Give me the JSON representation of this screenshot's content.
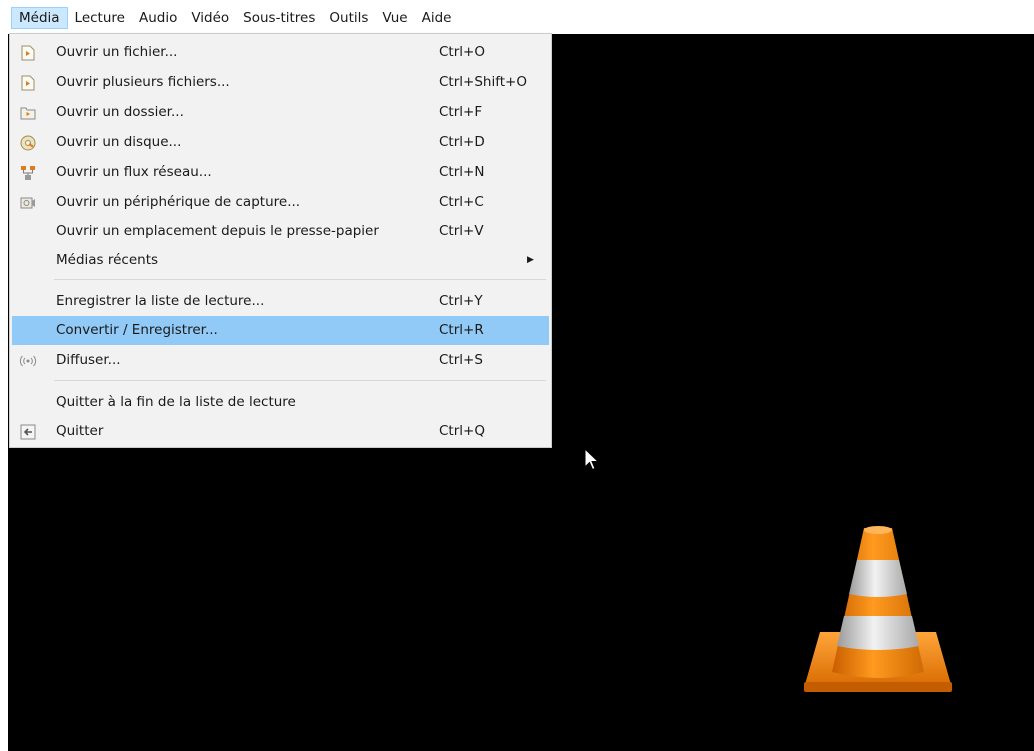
{
  "menubar": {
    "items": [
      {
        "label": "Média",
        "active": true
      },
      {
        "label": "Lecture"
      },
      {
        "label": "Audio"
      },
      {
        "label": "Vidéo"
      },
      {
        "label": "Sous-titres"
      },
      {
        "label": "Outils"
      },
      {
        "label": "Vue"
      },
      {
        "label": "Aide"
      }
    ]
  },
  "media_menu": {
    "open_file": {
      "label": "Ouvrir un fichier...",
      "shortcut": "Ctrl+O"
    },
    "open_files": {
      "label": "Ouvrir plusieurs fichiers...",
      "shortcut": "Ctrl+Shift+O"
    },
    "open_folder": {
      "label": "Ouvrir un dossier...",
      "shortcut": "Ctrl+F"
    },
    "open_disc": {
      "label": "Ouvrir un disque...",
      "shortcut": "Ctrl+D"
    },
    "open_network": {
      "label": "Ouvrir un flux réseau...",
      "shortcut": "Ctrl+N"
    },
    "open_capture": {
      "label": "Ouvrir un périphérique de capture...",
      "shortcut": "Ctrl+C"
    },
    "open_clipboard": {
      "label": "Ouvrir un emplacement depuis le presse-papier",
      "shortcut": "Ctrl+V"
    },
    "recent_media": {
      "label": "Médias récents"
    },
    "save_playlist": {
      "label": "Enregistrer la liste de lecture...",
      "shortcut": "Ctrl+Y"
    },
    "convert_save": {
      "label": "Convertir / Enregistrer...",
      "shortcut": "Ctrl+R",
      "highlighted": true
    },
    "stream": {
      "label": "Diffuser...",
      "shortcut": "Ctrl+S"
    },
    "quit_end_playlist": {
      "label": "Quitter à la fin de la liste de lecture"
    },
    "quit": {
      "label": "Quitter",
      "shortcut": "Ctrl+Q"
    }
  },
  "colors": {
    "highlight": "#91c9f7",
    "menu_bg": "#f2f2f2",
    "video_bg": "#000000",
    "cone_orange": "#f28a0f"
  },
  "icons": {
    "open_file": "file-play-icon",
    "open_files": "file-play-icon",
    "open_folder": "folder-play-icon",
    "open_disc": "disc-icon",
    "open_network": "network-icon",
    "open_capture": "capture-device-icon",
    "stream": "broadcast-icon",
    "quit": "exit-icon",
    "logo": "vlc-cone-logo"
  }
}
